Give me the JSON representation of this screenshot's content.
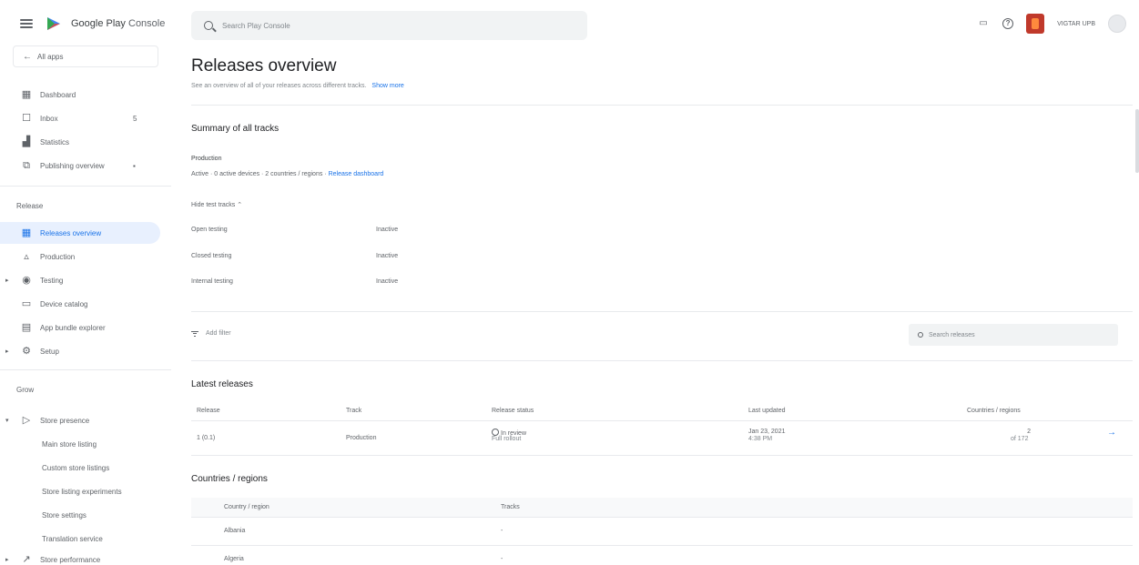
{
  "brand": {
    "name": "Google Play",
    "suffix": "Console"
  },
  "sidebar": {
    "all_apps": "All apps",
    "top_items": [
      {
        "label": "Dashboard",
        "icon": "dashboard-icon"
      },
      {
        "label": "Inbox",
        "icon": "inbox-icon",
        "count": "5"
      },
      {
        "label": "Statistics",
        "icon": "statistics-icon"
      },
      {
        "label": "Publishing overview",
        "icon": "publishing-icon"
      }
    ],
    "release_section": "Release",
    "release_items": [
      {
        "label": "Releases overview",
        "icon": "releases-overview-icon",
        "active": true
      },
      {
        "label": "Production",
        "icon": "production-icon"
      },
      {
        "label": "Testing",
        "icon": "testing-icon",
        "expandable": true
      },
      {
        "label": "Device catalog",
        "icon": "device-catalog-icon"
      },
      {
        "label": "App bundle explorer",
        "icon": "bundle-explorer-icon"
      },
      {
        "label": "Setup",
        "icon": "setup-icon",
        "expandable": true
      }
    ],
    "grow_section": "Grow",
    "grow_items": [
      {
        "label": "Store presence",
        "icon": "store-presence-icon",
        "expandable": true,
        "expanded": true
      },
      {
        "label": "Main store listing"
      },
      {
        "label": "Custom store listings"
      },
      {
        "label": "Store listing experiments"
      },
      {
        "label": "Store settings"
      },
      {
        "label": "Translation service"
      },
      {
        "label": "Store performance",
        "icon": "store-performance-icon",
        "expandable": true
      }
    ]
  },
  "header": {
    "search_placeholder": "Search Play Console",
    "app_name": "VIGTAR UPB"
  },
  "main": {
    "title": "Releases overview",
    "subtitle": "See an overview of all of your releases across different tracks.",
    "subtitle_link": "Show more",
    "summary_title": "Summary of all tracks",
    "production_label": "Production",
    "production_details": "Active · 0 active devices · 2 countries / regions ·",
    "production_link": "Release dashboard",
    "hide_tracks": "Hide test tracks",
    "tracks": [
      {
        "name": "Open testing",
        "status": "Inactive"
      },
      {
        "name": "Closed testing",
        "status": "Inactive"
      },
      {
        "name": "Internal testing",
        "status": "Inactive"
      }
    ],
    "filter_label": "Add filter",
    "search_releases": "Search releases",
    "latest_title": "Latest releases",
    "releases_columns": [
      "Release",
      "Track",
      "Release status",
      "Last updated",
      "Countries / regions"
    ],
    "releases": [
      {
        "release": "1 (0.1)",
        "track": "Production",
        "status": "In review",
        "status_sub": "Full rollout",
        "updated": "Jan 23, 2021",
        "updated_time": "4:38 PM",
        "countries": "2",
        "countries_of": "of 172"
      }
    ],
    "countries_title": "Countries / regions",
    "countries_columns": [
      "Country / region",
      "Tracks"
    ],
    "countries": [
      {
        "name": "Albania",
        "tracks": "-"
      },
      {
        "name": "Algeria",
        "tracks": "-"
      }
    ]
  }
}
